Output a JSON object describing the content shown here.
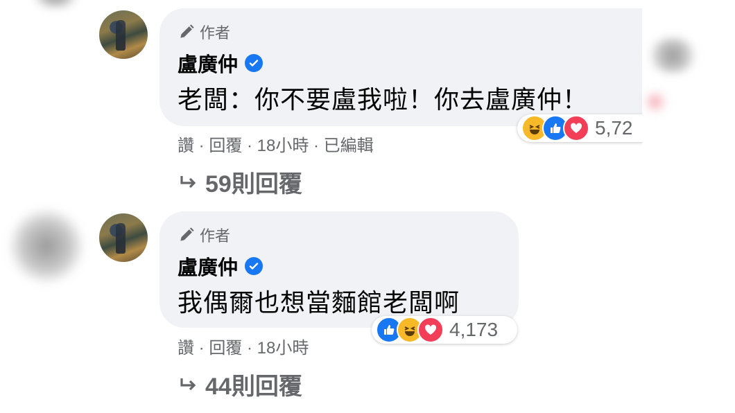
{
  "comments": [
    {
      "author_badge": "作者",
      "name": "盧廣仲",
      "text": "老闆：你不要盧我啦！你去盧廣仲！",
      "reaction_count": "5,72",
      "actions": "讚 · 回覆 · 18小時 · 已編輯",
      "replies": "59則回覆"
    },
    {
      "author_badge": "作者",
      "name": "盧廣仲",
      "text": "我偶爾也想當麵館老闆啊",
      "reaction_count": "4,173",
      "actions": "讚 · 回覆 · 18小時",
      "replies": "44則回覆"
    }
  ],
  "colors": {
    "bubble": "#f0f2f5",
    "verified": "#1877f2",
    "secondary_text": "#65676b",
    "like": "#1877f2",
    "haha": "#f7b928",
    "love": "#f33e58"
  }
}
